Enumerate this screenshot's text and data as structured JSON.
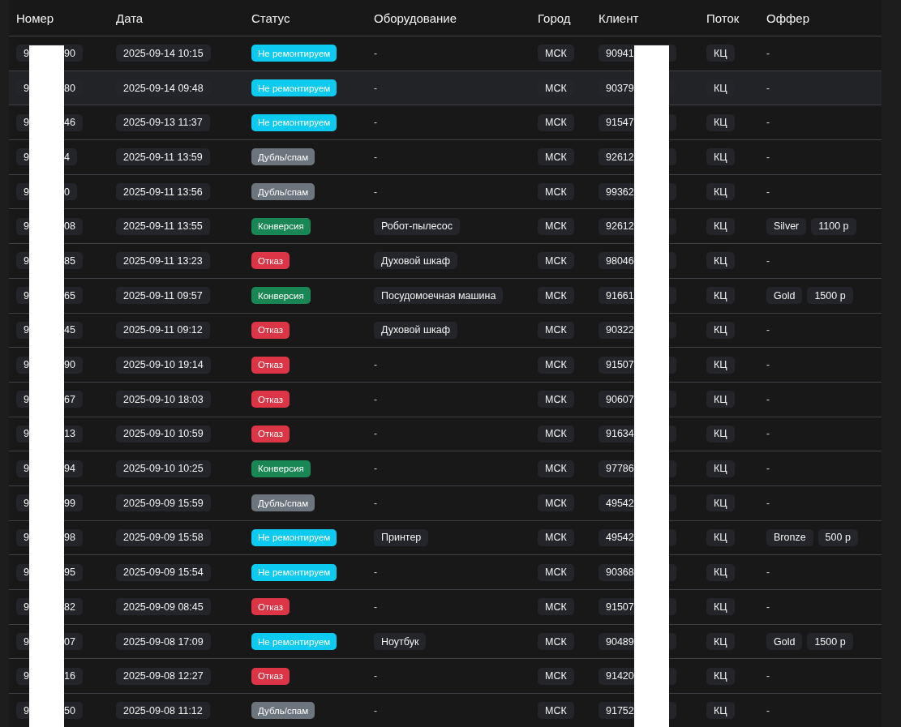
{
  "table": {
    "columns": [
      "Номер",
      "Дата",
      "Статус",
      "Оборудование",
      "Город",
      "Клиент",
      "Поток",
      "Оффер"
    ],
    "rows": [
      {
        "highlighted": false,
        "number": {
          "head": "9",
          "tail": "90"
        },
        "date": "2025-09-14 10:15",
        "status": {
          "label": "Не ремонтируем",
          "color": "#0dcaf0"
        },
        "equipment": {
          "kind": "plain",
          "text": "-"
        },
        "city": "МСК",
        "client": "90941",
        "flow": "КЦ",
        "offer": {
          "kind": "plain",
          "text": "-"
        }
      },
      {
        "highlighted": true,
        "number": {
          "head": "9",
          "tail": "80"
        },
        "date": "2025-09-14 09:48",
        "status": {
          "label": "Не ремонтируем",
          "color": "#0dcaf0"
        },
        "equipment": {
          "kind": "plain",
          "text": "-"
        },
        "city": "МСК",
        "client": "90379",
        "flow": "КЦ",
        "offer": {
          "kind": "plain",
          "text": "-"
        }
      },
      {
        "highlighted": false,
        "number": {
          "head": "9",
          "tail": "46"
        },
        "date": "2025-09-13 11:37",
        "status": {
          "label": "Не ремонтируем",
          "color": "#0dcaf0"
        },
        "equipment": {
          "kind": "plain",
          "text": "-"
        },
        "city": "МСК",
        "client": "91547",
        "flow": "КЦ",
        "offer": {
          "kind": "plain",
          "text": "-"
        }
      },
      {
        "highlighted": false,
        "number": {
          "head": "9",
          "tail": "4"
        },
        "date": "2025-09-11 13:59",
        "status": {
          "label": "Дубль/спам",
          "color": "#6c757d"
        },
        "equipment": {
          "kind": "plain",
          "text": "-"
        },
        "city": "МСК",
        "client": "92612",
        "flow": "КЦ",
        "offer": {
          "kind": "plain",
          "text": "-"
        }
      },
      {
        "highlighted": false,
        "number": {
          "head": "9",
          "tail": "0"
        },
        "date": "2025-09-11 13:56",
        "status": {
          "label": "Дубль/спам",
          "color": "#6c757d"
        },
        "equipment": {
          "kind": "plain",
          "text": "-"
        },
        "city": "МСК",
        "client": "99362",
        "flow": "КЦ",
        "offer": {
          "kind": "plain",
          "text": "-"
        }
      },
      {
        "highlighted": false,
        "number": {
          "head": "9",
          "tail": "08"
        },
        "date": "2025-09-11 13:55",
        "status": {
          "label": "Конверсия",
          "color": "#198754"
        },
        "equipment": {
          "kind": "tag",
          "text": "Робот-пылесос"
        },
        "city": "МСК",
        "client": "92612",
        "flow": "КЦ",
        "offer": {
          "kind": "tags",
          "tier": "Silver",
          "price": "1100 р"
        }
      },
      {
        "highlighted": false,
        "number": {
          "head": "9",
          "tail": "85"
        },
        "date": "2025-09-11 13:23",
        "status": {
          "label": "Отказ",
          "color": "#dc3545"
        },
        "equipment": {
          "kind": "tag",
          "text": "Духовой шкаф"
        },
        "city": "МСК",
        "client": "98046",
        "flow": "КЦ",
        "offer": {
          "kind": "plain",
          "text": "-"
        }
      },
      {
        "highlighted": false,
        "number": {
          "head": "9",
          "tail": "65"
        },
        "date": "2025-09-11 09:57",
        "status": {
          "label": "Конверсия",
          "color": "#198754"
        },
        "equipment": {
          "kind": "tag",
          "text": "Посудомоечная машина"
        },
        "city": "МСК",
        "client": "91661",
        "flow": "КЦ",
        "offer": {
          "kind": "tags",
          "tier": "Gold",
          "price": "1500 р"
        }
      },
      {
        "highlighted": false,
        "number": {
          "head": "9",
          "tail": "45"
        },
        "date": "2025-09-11 09:12",
        "status": {
          "label": "Отказ",
          "color": "#dc3545"
        },
        "equipment": {
          "kind": "tag",
          "text": "Духовой шкаф"
        },
        "city": "МСК",
        "client": "90322",
        "flow": "КЦ",
        "offer": {
          "kind": "plain",
          "text": "-"
        }
      },
      {
        "highlighted": false,
        "number": {
          "head": "9",
          "tail": "90"
        },
        "date": "2025-09-10 19:14",
        "status": {
          "label": "Отказ",
          "color": "#dc3545"
        },
        "equipment": {
          "kind": "plain",
          "text": "-"
        },
        "city": "МСК",
        "client": "91507",
        "flow": "КЦ",
        "offer": {
          "kind": "plain",
          "text": "-"
        }
      },
      {
        "highlighted": false,
        "number": {
          "head": "9",
          "tail": "67"
        },
        "date": "2025-09-10 18:03",
        "status": {
          "label": "Отказ",
          "color": "#dc3545"
        },
        "equipment": {
          "kind": "plain",
          "text": "-"
        },
        "city": "МСК",
        "client": "90607",
        "flow": "КЦ",
        "offer": {
          "kind": "plain",
          "text": "-"
        }
      },
      {
        "highlighted": false,
        "number": {
          "head": "9",
          "tail": "13"
        },
        "date": "2025-09-10 10:59",
        "status": {
          "label": "Отказ",
          "color": "#dc3545"
        },
        "equipment": {
          "kind": "plain",
          "text": "-"
        },
        "city": "МСК",
        "client": "91634",
        "flow": "КЦ",
        "offer": {
          "kind": "plain",
          "text": "-"
        }
      },
      {
        "highlighted": false,
        "number": {
          "head": "9",
          "tail": "94"
        },
        "date": "2025-09-10 10:25",
        "status": {
          "label": "Конверсия",
          "color": "#198754"
        },
        "equipment": {
          "kind": "plain",
          "text": "-"
        },
        "city": "МСК",
        "client": "97786",
        "flow": "КЦ",
        "offer": {
          "kind": "plain",
          "text": "-"
        }
      },
      {
        "highlighted": false,
        "number": {
          "head": "9",
          "tail": "99"
        },
        "date": "2025-09-09 15:59",
        "status": {
          "label": "Дубль/спам",
          "color": "#6c757d"
        },
        "equipment": {
          "kind": "plain",
          "text": "-"
        },
        "city": "МСК",
        "client": "49542",
        "flow": "КЦ",
        "offer": {
          "kind": "plain",
          "text": "-"
        }
      },
      {
        "highlighted": false,
        "number": {
          "head": "9",
          "tail": "98"
        },
        "date": "2025-09-09 15:58",
        "status": {
          "label": "Не ремонтируем",
          "color": "#0dcaf0"
        },
        "equipment": {
          "kind": "tag",
          "text": "Принтер"
        },
        "city": "МСК",
        "client": "49542",
        "flow": "КЦ",
        "offer": {
          "kind": "tags",
          "tier": "Bronze",
          "price": "500 р"
        }
      },
      {
        "highlighted": false,
        "number": {
          "head": "9",
          "tail": "95"
        },
        "date": "2025-09-09 15:54",
        "status": {
          "label": "Не ремонтируем",
          "color": "#0dcaf0"
        },
        "equipment": {
          "kind": "plain",
          "text": "-"
        },
        "city": "МСК",
        "client": "90368",
        "flow": "КЦ",
        "offer": {
          "kind": "plain",
          "text": "-"
        }
      },
      {
        "highlighted": false,
        "number": {
          "head": "9",
          "tail": "82"
        },
        "date": "2025-09-09 08:45",
        "status": {
          "label": "Отказ",
          "color": "#dc3545"
        },
        "equipment": {
          "kind": "plain",
          "text": "-"
        },
        "city": "МСК",
        "client": "91507",
        "flow": "КЦ",
        "offer": {
          "kind": "plain",
          "text": "-"
        }
      },
      {
        "highlighted": false,
        "number": {
          "head": "9",
          "tail": "07"
        },
        "date": "2025-09-08 17:09",
        "status": {
          "label": "Не ремонтируем",
          "color": "#0dcaf0"
        },
        "equipment": {
          "kind": "tag",
          "text": "Ноутбук"
        },
        "city": "МСК",
        "client": "90489",
        "flow": "КЦ",
        "offer": {
          "kind": "tags",
          "tier": "Gold",
          "price": "1500 р"
        }
      },
      {
        "highlighted": false,
        "number": {
          "head": "9",
          "tail": "16"
        },
        "date": "2025-09-08 12:27",
        "status": {
          "label": "Отказ",
          "color": "#dc3545"
        },
        "equipment": {
          "kind": "plain",
          "text": "-"
        },
        "city": "МСК",
        "client": "91420",
        "flow": "КЦ",
        "offer": {
          "kind": "plain",
          "text": "-"
        }
      },
      {
        "highlighted": false,
        "number": {
          "head": "9",
          "tail": "50"
        },
        "date": "2025-09-08 11:12",
        "status": {
          "label": "Дубль/спам",
          "color": "#6c757d"
        },
        "equipment": {
          "kind": "plain",
          "text": "-"
        },
        "city": "МСК",
        "client": "91752",
        "flow": "КЦ",
        "offer": {
          "kind": "plain",
          "text": "-"
        }
      }
    ]
  }
}
